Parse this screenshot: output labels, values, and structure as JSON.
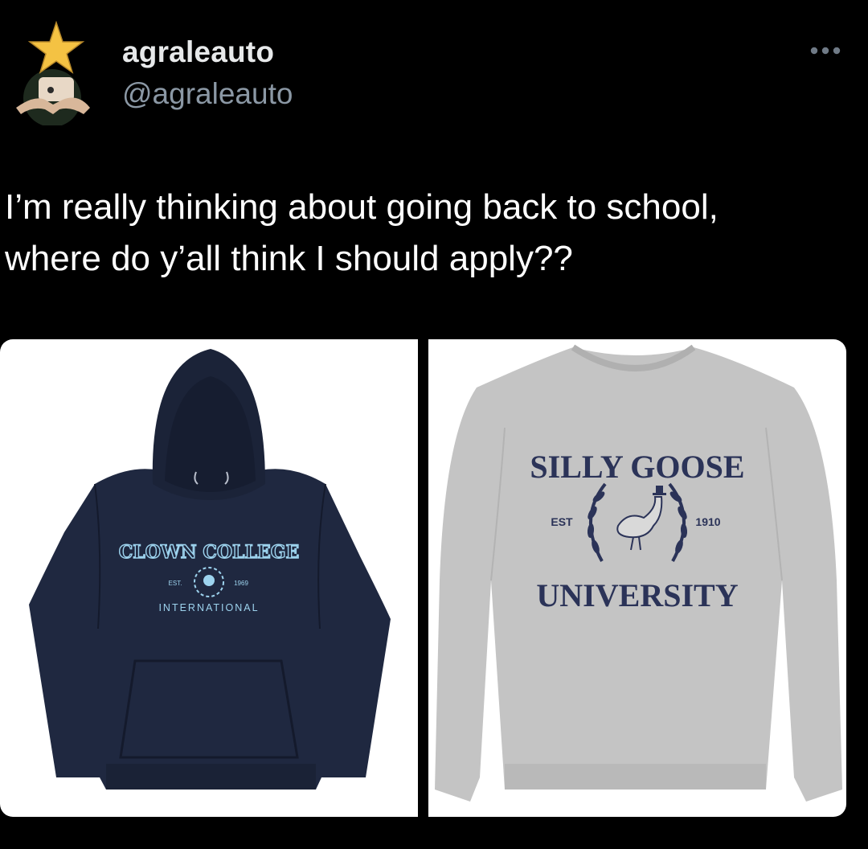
{
  "author": {
    "display_name": "agraleauto",
    "handle": "@agraleauto",
    "avatar_icon": "star-character-avatar"
  },
  "more_icon": "more-options-icon",
  "tweet": {
    "line1": "I’m really thinking about going back to school,",
    "line2": "where do y’all think I should apply??"
  },
  "media": [
    {
      "description_icon": "navy-hoodie-image",
      "logo_title": "CLOWN COLLEGE",
      "logo_est": "EST.",
      "logo_year": "1969",
      "logo_subtitle": "INTERNATIONAL"
    },
    {
      "description_icon": "grey-sweatshirt-image",
      "logo_title": "SILLY GOOSE",
      "logo_est": "EST",
      "logo_year": "1910",
      "logo_subtitle": "UNIVERSITY"
    }
  ],
  "colors": {
    "background": "#000000",
    "text": "#ffffff",
    "handle": "#8b98a5",
    "hoodie": "#1f2840",
    "hoodie_print": "#9dd3ee",
    "sweatshirt": "#c4c4c4",
    "sweatshirt_print": "#2b3358"
  }
}
